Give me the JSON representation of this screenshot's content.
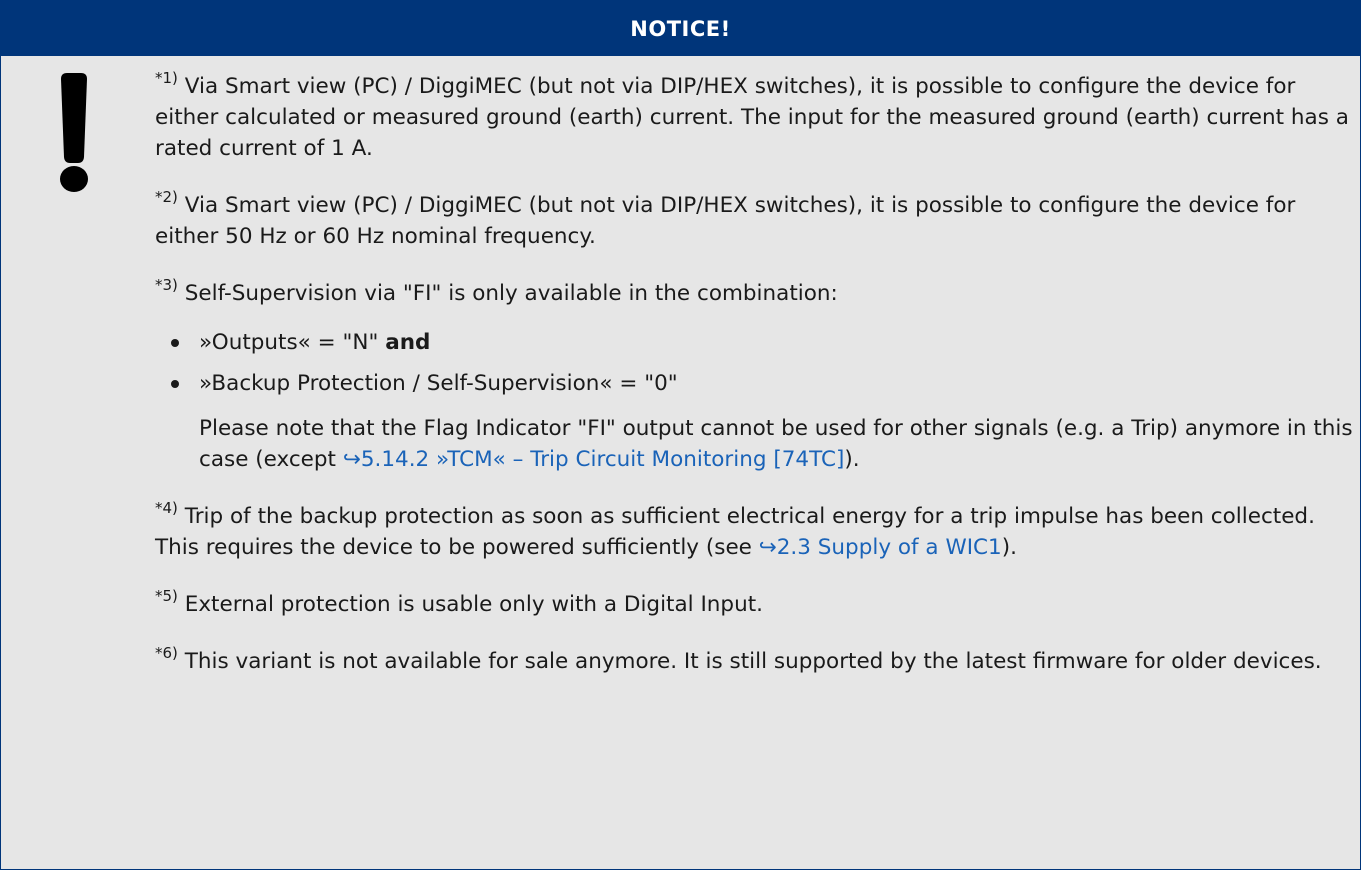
{
  "header": {
    "title": "NOTICE!"
  },
  "icon": {
    "name": "exclamation-icon",
    "color": "#000000"
  },
  "colors": {
    "header_bg": "#00357a",
    "body_bg": "#e6e6e6",
    "link": "#1a63b8"
  },
  "notes": {
    "n1": {
      "marker": "*1)",
      "text": " Via Smart view (PC) / DiggiMEC (but not via DIP/HEX switches), it is possible to configure the device for either calculated or measured ground (earth) current. The input for the measured ground (earth) current has a rated current of 1 A."
    },
    "n2": {
      "marker": "*2)",
      "text": " Via Smart view (PC) / DiggiMEC (but not via DIP/HEX switches), it is possible to configure the device for either 50 Hz or 60 Hz nominal frequency."
    },
    "n3": {
      "marker": "*3)",
      "text": " Self-Supervision via \"FI\" is only available in the combination:",
      "bullet1_text": "»Outputs« = \"N\" ",
      "bullet1_bold": "and",
      "bullet2_text": "»Backup Protection / Self-Supervision« = \"0\"",
      "note_before": "Please note that the Flag Indicator \"FI\" output cannot be used for other signals (e.g. a Trip) anymore in this case (except ",
      "note_link": "↪5.14.2 »TCM« – Trip Circuit Monitoring [74TC]",
      "note_after": ")."
    },
    "n4": {
      "marker": "*4)",
      "text_before": " Trip of the backup protection as soon as sufficient electrical energy for a trip impulse has been collected. This requires the device to be powered sufficiently (see ",
      "link": "↪2.3 Supply of a WIC1",
      "text_after": ")."
    },
    "n5": {
      "marker": "*5)",
      "text": " External protection is usable only with a Digital Input."
    },
    "n6": {
      "marker": "*6)",
      "text": " This variant is not available for sale anymore. It is still supported by the latest firmware for older devices."
    }
  }
}
